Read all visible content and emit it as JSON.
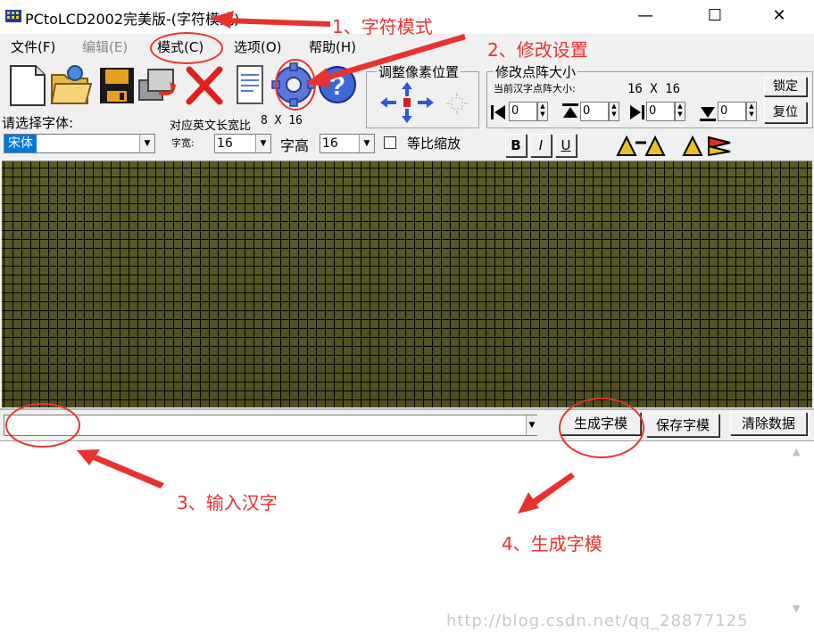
{
  "window": {
    "title": "PCtoLCD2002完美版-(字符模式)",
    "minimize_glyph": "—",
    "maximize_glyph": "☐",
    "close_glyph": "✕"
  },
  "menu": {
    "file": "文件(F)",
    "edit": "编辑(E)",
    "mode": "模式(C)",
    "options": "选项(O)",
    "help": "帮助(H)"
  },
  "toolbar": {
    "icons": [
      "new-file-icon",
      "open-folder-icon",
      "save-disk-icon",
      "import-image-icon",
      "delete-x-icon",
      "notepad-icon",
      "settings-gear-icon",
      "help-question-icon"
    ],
    "adjust_pixel_title": "调整像素位置",
    "resize_title": "修改点阵大小",
    "current_size_label": "当前汉字点阵大小:",
    "current_size_value": "16 X 16",
    "lock_button": "锁定",
    "reset_button": "复位",
    "spin_values": [
      "0",
      "0",
      "0",
      "0"
    ]
  },
  "font_row": {
    "select_font_label": "请选择字体:",
    "font_value": "宋体",
    "ascii_ratio_label": "对应英文长宽比",
    "ascii_ratio_value": "8 X 16",
    "width_label": "字宽:",
    "width_value": "16",
    "height_label": "字高",
    "height_value": "16",
    "proportional_label": "等比缩放",
    "bold": "B",
    "italic": "I",
    "underline": "U"
  },
  "actions": {
    "generate": "生成字模",
    "save": "保存字模",
    "clear": "清除数据"
  },
  "annotations": {
    "a1": "1、字符模式",
    "a2": "2、修改设置",
    "a3": "3、输入汉字",
    "a4": "4、生成字模",
    "color": "#e8322e"
  },
  "watermark": "http://blog.csdn.net/qq_28877125"
}
